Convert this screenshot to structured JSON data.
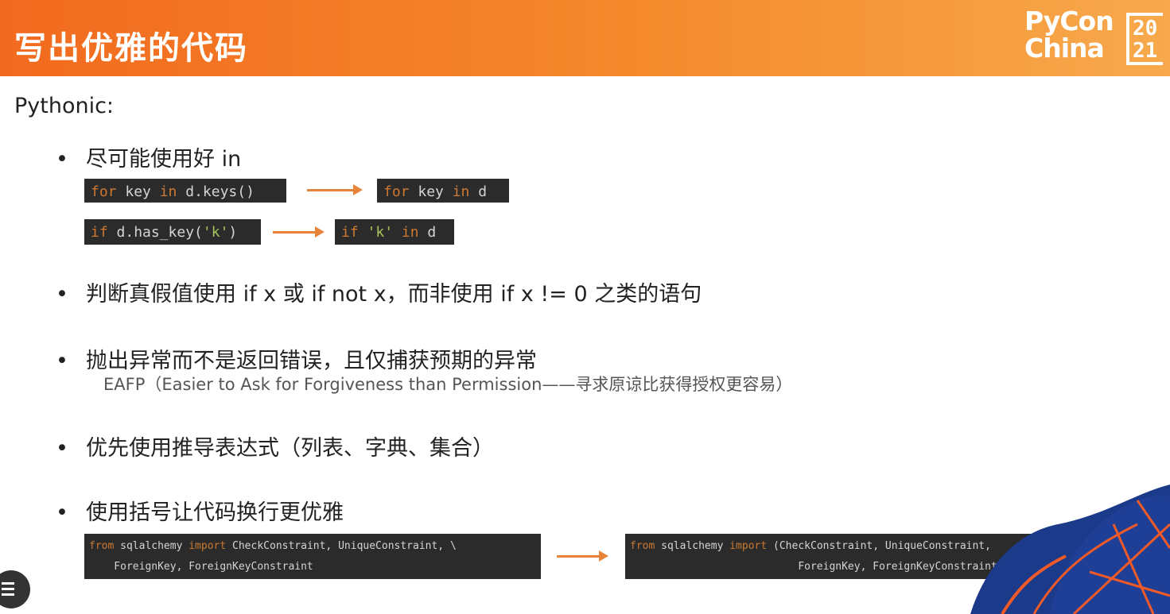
{
  "header": {
    "title": "写出优雅的代码",
    "logo": {
      "line1": "PyCon",
      "line2": "China",
      "year_top": "20",
      "year_bottom": "21"
    }
  },
  "intro": "Pythonic:",
  "bullets": [
    {
      "text": "尽可能使用好 in"
    },
    {
      "text": "判断真假值使用 if x 或 if not x，而非使用 if x != 0 之类的语句"
    },
    {
      "text": "抛出异常而不是返回错误，且仅捕获预期的异常",
      "sub": "EAFP（Easier to Ask for Forgiveness than Permission——寻求原谅比获得授权更容易）"
    },
    {
      "text": "优先使用推导表达式（列表、字典、集合）"
    },
    {
      "text": "使用括号让代码换行更优雅"
    }
  ],
  "code": {
    "for_keys": {
      "kw1": "for",
      "mid": " key ",
      "kw2": "in",
      "tail": " d.keys()"
    },
    "for_in": {
      "kw1": "for",
      "mid": " key ",
      "kw2": "in",
      "tail": " d"
    },
    "has_key": {
      "kw1": "if",
      "pre": " d.has_key(",
      "str": "'k'",
      "post": ")"
    },
    "if_in": {
      "kw1": "if",
      "str": " 'k' ",
      "kw2": "in",
      "tail": " d"
    },
    "import_backslash": {
      "kw1": "from",
      "mid1": " sqlalchemy ",
      "kw2": "import",
      "line1_tail": " CheckConstraint, UniqueConstraint, \\",
      "line2": "    ForeignKey, ForeignKeyConstraint"
    },
    "import_paren": {
      "kw1": "from",
      "mid1": " sqlalchemy ",
      "kw2": "import",
      "line1_tail": " (CheckConstraint, UniqueConstraint,",
      "line2": "                           ForeignKey, ForeignKeyConstraint)"
    }
  },
  "colors": {
    "header_start": "#f26a1f",
    "header_end": "#f7a94c",
    "arrow": "#e8843a",
    "keyword": "#cc7832",
    "string": "#a5c25c",
    "code_bg": "#2b2b2b"
  },
  "icons": {
    "menu": "menu-icon"
  }
}
